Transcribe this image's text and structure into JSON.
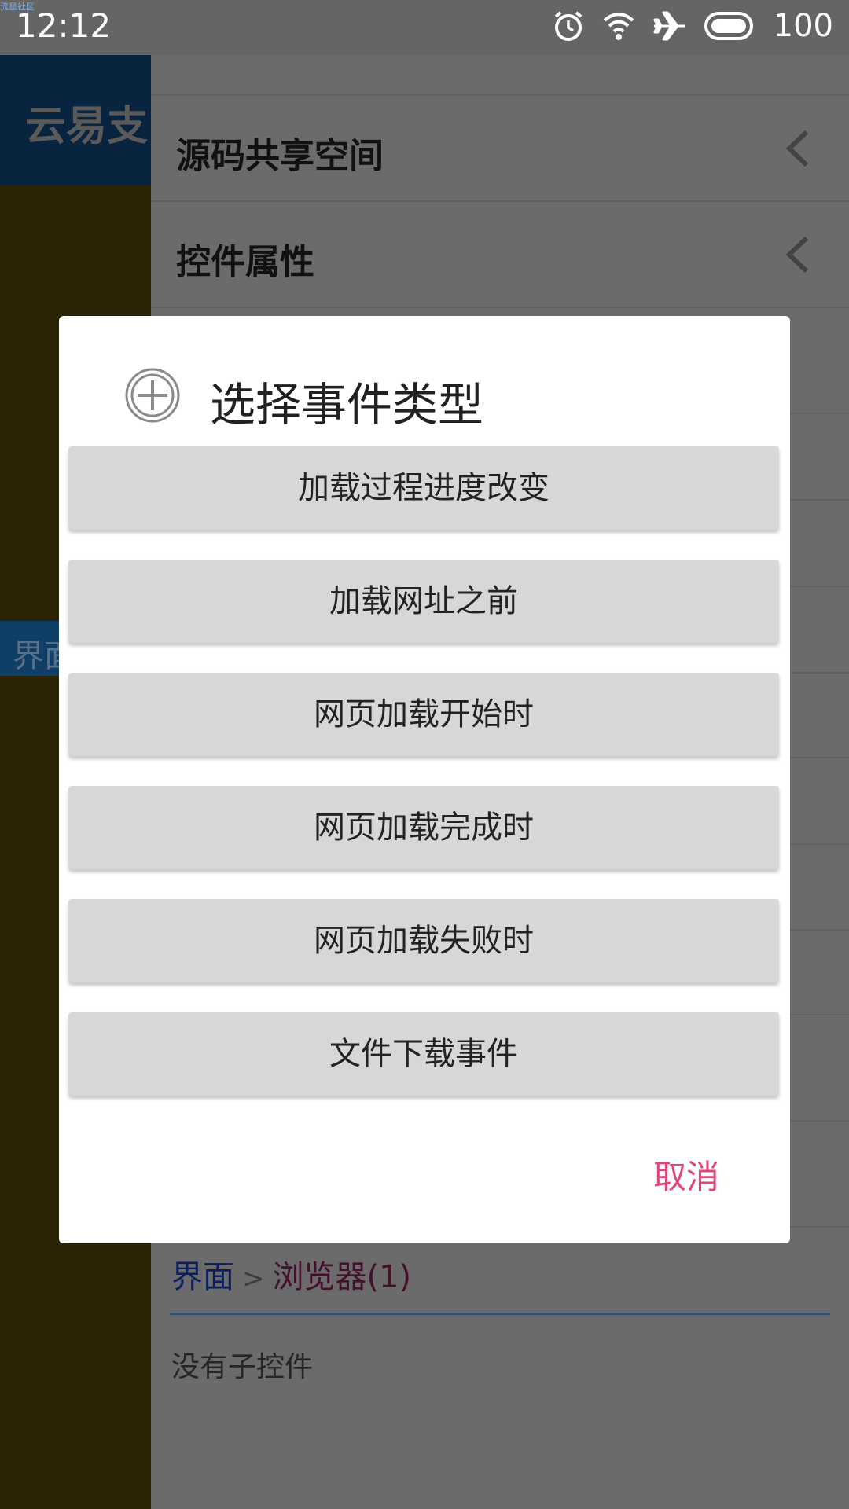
{
  "status_bar": {
    "time": "12:12",
    "overlay_text": "流星社区",
    "battery": "100",
    "icons": [
      "alarm-icon",
      "wifi-icon",
      "airplane-icon",
      "battery-icon"
    ]
  },
  "drawer": {
    "header_text": "云易支",
    "tab_text": "界面"
  },
  "list": {
    "items": [
      {
        "label": "源码共享空间",
        "icon": "chevron-left-icon"
      },
      {
        "label": "控件属性",
        "icon": "chevron-left-icon"
      }
    ]
  },
  "breadcrumb": {
    "root": "界面",
    "separator": ">",
    "current": "浏览器(1)"
  },
  "empty_text": "没有子控件",
  "dialog": {
    "title": "选择事件类型",
    "icon": "add-circle-icon",
    "options": [
      "加载过程进度改变",
      "加载网址之前",
      "网页加载开始时",
      "网页加载完成时",
      "网页加载失败时",
      "文件下载事件"
    ],
    "cancel_label": "取消"
  },
  "colors": {
    "accent_pink": "#e0457b",
    "dialog_button_bg": "#d6d7d7",
    "breadcrumb_link": "#0a1f5e"
  }
}
